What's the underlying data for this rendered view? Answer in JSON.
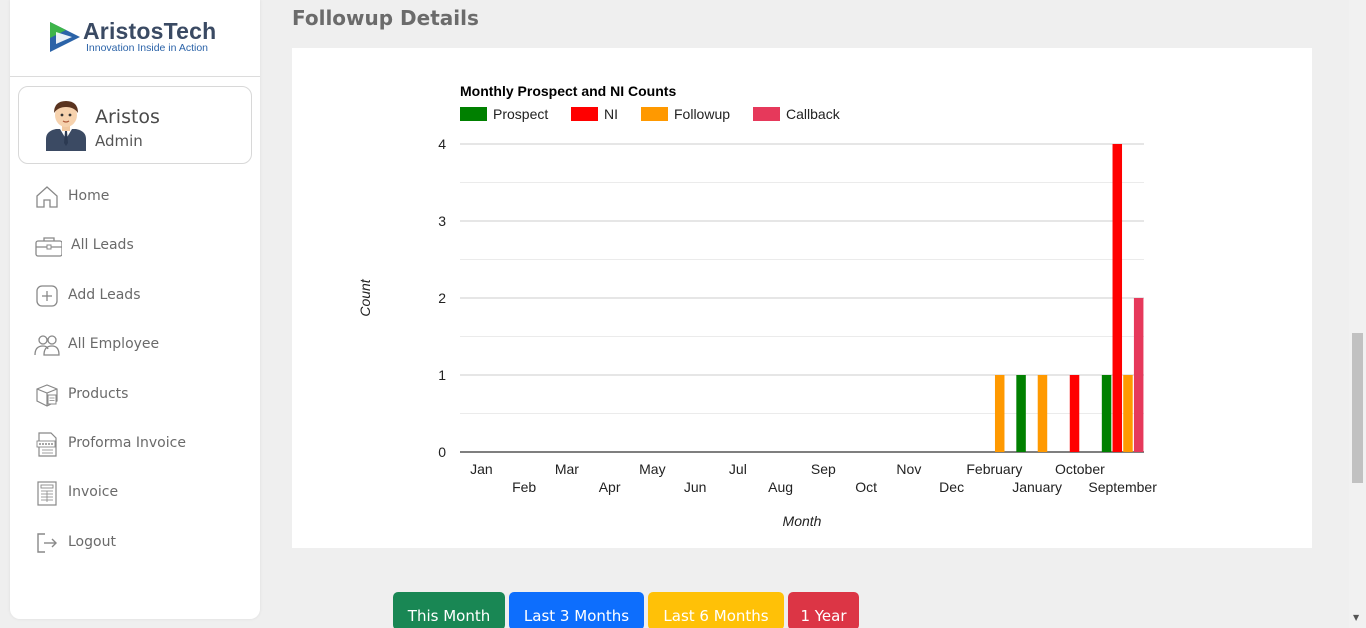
{
  "brand": {
    "name": "AristosTech",
    "tagline": "Innovation Inside in Action"
  },
  "user": {
    "name": "Aristos",
    "role": "Admin"
  },
  "menu": [
    {
      "label": "Home",
      "icon": "home-icon"
    },
    {
      "label": "All Leads",
      "icon": "briefcase-icon"
    },
    {
      "label": "Add Leads",
      "icon": "plus-square-icon"
    },
    {
      "label": "All Employee",
      "icon": "users-icon"
    },
    {
      "label": "Products",
      "icon": "package-icon"
    },
    {
      "label": "Proforma Invoice",
      "icon": "invoice-doc-icon"
    },
    {
      "label": "Invoice",
      "icon": "receipt-icon"
    },
    {
      "label": "Logout",
      "icon": "logout-icon"
    }
  ],
  "page": {
    "title": "Followup Details"
  },
  "chart_data": {
    "type": "bar",
    "title": "Monthly Prospect and NI Counts",
    "xlabel": "Month",
    "ylabel": "Count",
    "ylim": [
      0,
      4
    ],
    "yticks": [
      "0",
      "1",
      "2",
      "3",
      "4"
    ],
    "grid": true,
    "legend_position": "top-left",
    "categories": [
      "Jan",
      "Feb",
      "Mar",
      "Apr",
      "May",
      "Jun",
      "Jul",
      "Aug",
      "Sep",
      "Oct",
      "Nov",
      "Dec",
      "February",
      "January",
      "October",
      "September"
    ],
    "series": [
      {
        "name": "Prospect",
        "color": "#008000",
        "values": [
          0,
          0,
          0,
          0,
          0,
          0,
          0,
          0,
          0,
          0,
          0,
          0,
          0,
          1,
          0,
          1
        ]
      },
      {
        "name": "NI",
        "color": "#ff0000",
        "values": [
          0,
          0,
          0,
          0,
          0,
          0,
          0,
          0,
          0,
          0,
          0,
          0,
          0,
          0,
          1,
          4
        ]
      },
      {
        "name": "Followup",
        "color": "#ff9900",
        "values": [
          0,
          0,
          0,
          0,
          0,
          0,
          0,
          0,
          0,
          0,
          0,
          0,
          1,
          1,
          0,
          1
        ]
      },
      {
        "name": "Callback",
        "color": "#e6395b",
        "values": [
          0,
          0,
          0,
          0,
          0,
          0,
          0,
          0,
          0,
          0,
          0,
          0,
          0,
          0,
          0,
          2
        ]
      }
    ]
  },
  "filters": {
    "this_month": "This Month",
    "last3": "Last 3 Months",
    "last6": "Last 6 Months",
    "year": "1 Year"
  }
}
